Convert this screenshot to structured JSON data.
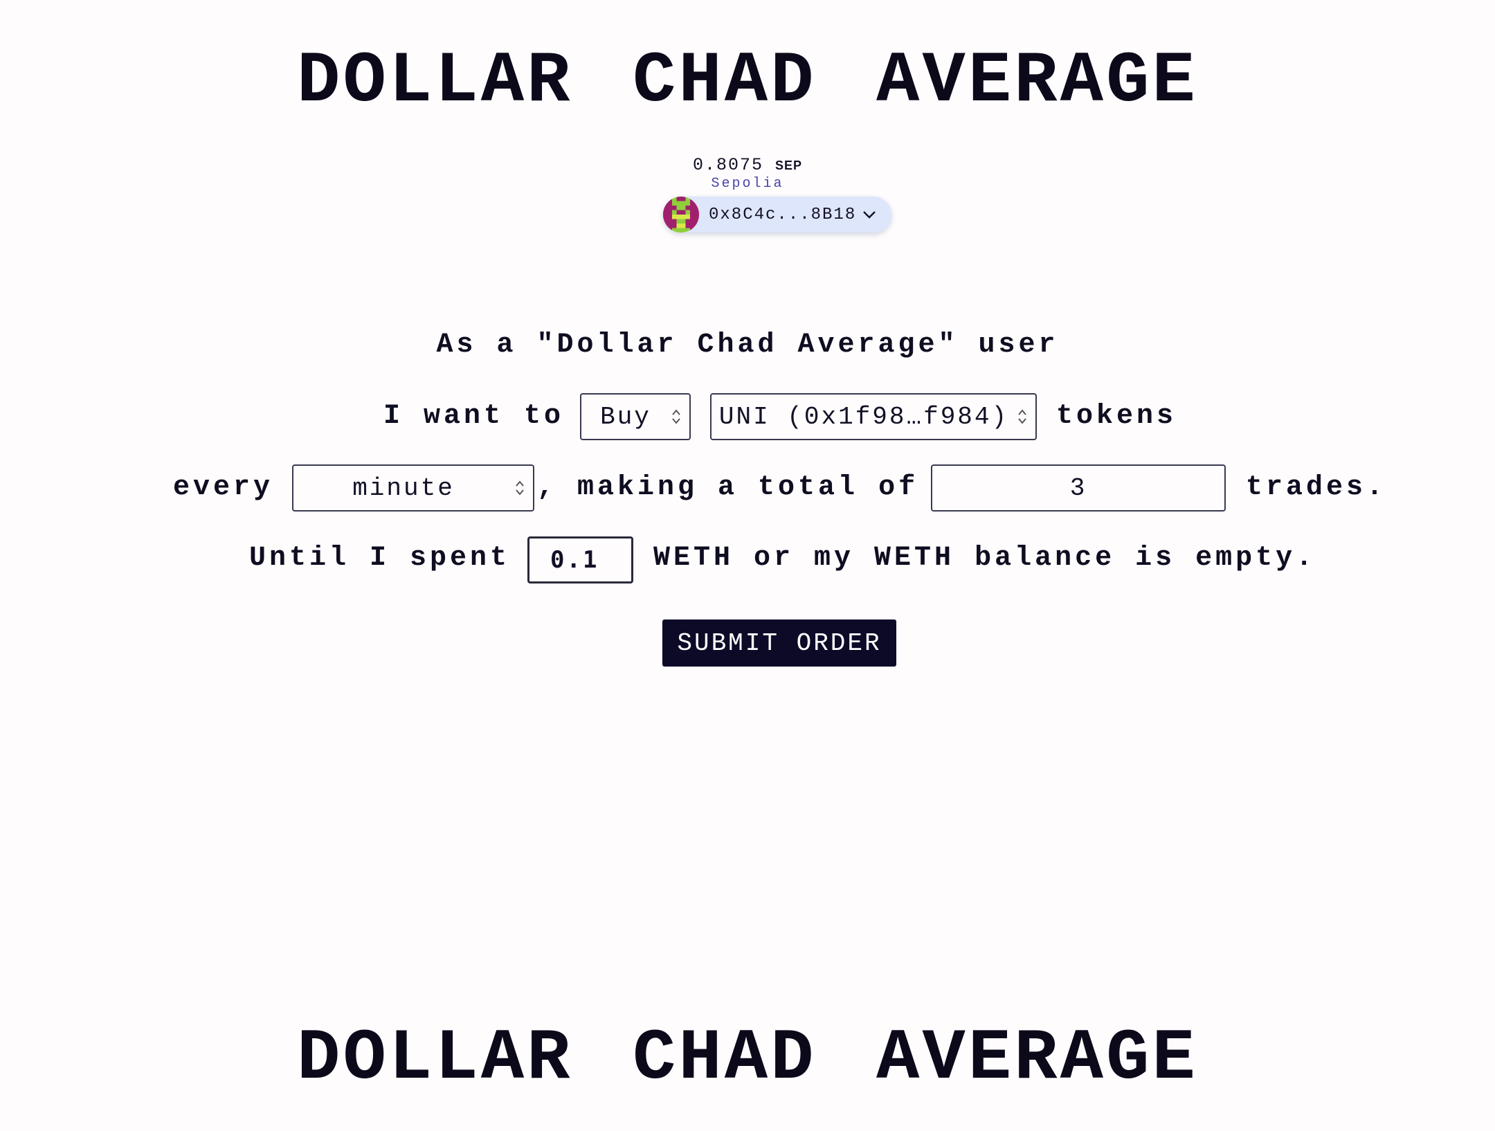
{
  "header": {
    "title": "DOLLAR CHAD AVERAGE"
  },
  "wallet": {
    "balance_value": "0.8075",
    "balance_unit": "SEP",
    "network": "Sepolia",
    "address": "0x8C4c...8B18",
    "avatar_icon": "pixel-avatar-icon",
    "dropdown_icon": "chevron-down-icon",
    "pill_color": "#dde6fb"
  },
  "form": {
    "intro": "As a \"Dollar Chad Average\" user",
    "i_want_to": "I want to",
    "action_select": {
      "value": "Buy",
      "options": [
        "Buy"
      ]
    },
    "token_select": {
      "value": "UNI (0x1f98…f984)"
    },
    "tokens_label": "tokens",
    "every_label": "every",
    "interval_select": {
      "value": "minute"
    },
    "making_label": ", making a total of",
    "trades_input": {
      "value": "3"
    },
    "trades_label": "trades.",
    "until_label": "Until I spent",
    "amount_input": {
      "value": "0.1"
    },
    "until_tail": "WETH or my WETH balance is empty.",
    "submit_label": "SUBMIT ORDER",
    "submit_color": "#0d0a28"
  },
  "footer": {
    "title": "DOLLAR CHAD AVERAGE"
  }
}
